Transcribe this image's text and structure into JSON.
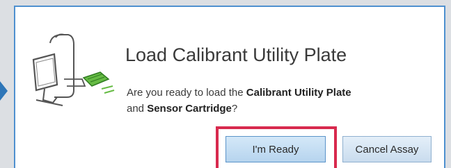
{
  "dialog": {
    "title": "Load Calibrant Utility Plate",
    "message": {
      "part1": "Are you ready to load the ",
      "bold1": "Calibrant Utility Plate",
      "part2": "and ",
      "bold2": "Sensor Cartridge",
      "part3": "?"
    },
    "illustration_icon": "instrument-loading-illustration"
  },
  "buttons": {
    "ready_label": "I'm Ready",
    "cancel_label": "Cancel Assay"
  },
  "colors": {
    "dialog_border": "#4e90cf",
    "highlight": "#d82a4e",
    "pointer": "#2e76b8",
    "plate_accent": "#66bb44"
  }
}
